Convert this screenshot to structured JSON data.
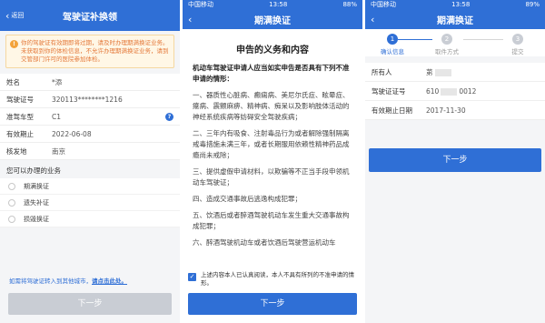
{
  "panel1": {
    "back_label": "返回",
    "title": "驾驶证补换领",
    "warning": "你的驾驶证有效期即将过期，请及时办理期满换证业务。未获取到你的体检信息，不允许办理期满换证业务，请到交管部门许可的医院参加体检。",
    "fields": [
      {
        "label": "姓名",
        "value": "*添"
      },
      {
        "label": "驾驶证号",
        "value": "320113********1216"
      },
      {
        "label": "准驾车型",
        "value": "C1"
      },
      {
        "label": "有效期止",
        "value": "2022-06-08"
      },
      {
        "label": "核发地",
        "value": "南京"
      }
    ],
    "section_title": "您可以办理的业务",
    "options": [
      "期满换证",
      "遗失补证",
      "损毁换证"
    ],
    "link_prefix": "如需将驾驶证转入到其他城市，",
    "link_text": "请点击此处。",
    "next_button": "下一步"
  },
  "panel2": {
    "carrier": "中国移动",
    "time": "13:58",
    "battery": "88%",
    "title": "期满换证",
    "doc_title": "申告的义务和内容",
    "intro": "机动车驾驶证申请人应当如实申告是否具有下列不准申请的情形：",
    "items": [
      "一、器质性心脏病、癫痫病、美尼尔氏症、眩晕症、癔病、震颤麻痹、精神病、痴呆以及影响肢体活动的神经系统疾病等妨碍安全驾驶疾病；",
      "二、三年内有吸食、注射毒品行为或者解除强制隔离戒毒措施未满三年，或者长期服用依赖性精神药品成瘾尚未戒除；",
      "三、提供虚假申请材料，以欺骗等不正当手段申领机动车驾驶证；",
      "四、造成交通事故后逃逸构成犯罪；",
      "五、饮酒后或者醉酒驾驶机动车发生重大交通事故构成犯罪；",
      "六、醉酒驾驶机动车或者饮酒后驾驶营运机动车"
    ],
    "agree_text": "上述内容本人已认真阅读，本人不具有所列的不准申请的情形。",
    "next_button": "下一步"
  },
  "panel3": {
    "carrier": "中国移动",
    "time": "13:58",
    "battery": "89%",
    "title": "期满换证",
    "steps": [
      {
        "num": "1",
        "label": "确认信息"
      },
      {
        "num": "2",
        "label": "取件方式"
      },
      {
        "num": "3",
        "label": "提交"
      }
    ],
    "fields": [
      {
        "label": "所有人",
        "value_prefix": "苐",
        "value_suffix": ""
      },
      {
        "label": "驾驶证证号",
        "value_prefix": "610",
        "value_suffix": "0012"
      },
      {
        "label": "有效期止日期",
        "value_prefix": "2017-11-30",
        "value_suffix": ""
      }
    ],
    "next_button": "下一步"
  }
}
